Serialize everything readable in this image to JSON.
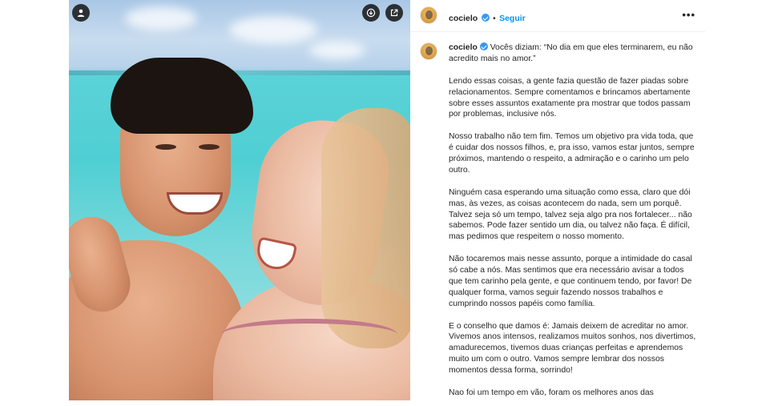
{
  "post": {
    "username": "cocielo",
    "follow_label": "Seguir",
    "separator": "•",
    "more_label": "•••"
  },
  "photo": {
    "description_icon": "user-icon",
    "top_right_icons": [
      "download-icon",
      "open-external-icon"
    ]
  },
  "caption": {
    "username": "cocielo",
    "paragraphs": [
      "Vocês diziam: “No dia em que eles terminarem, eu não acredito mais no amor.”",
      "Lendo essas coisas, a gente fazia questão de fazer piadas sobre relacionamentos. Sempre comentamos e brincamos abertamente sobre esses assuntos exatamente pra mostrar que todos passam por problemas, inclusive nós.",
      "Nosso trabalho não tem fim. Temos um objetivo pra vida toda, que é cuidar dos nossos filhos, e, pra isso, vamos estar juntos, sempre próximos, mantendo o respeito, a admiração e o carinho um pelo outro.",
      "Ninguém casa esperando uma situação como essa, claro que dói mas, às vezes, as coisas acontecem do nada, sem um porquê. Talvez seja só um tempo, talvez seja algo pra nos fortalecer... não sabemos. Pode fazer sentido um dia, ou talvez não faça. É difícil, mas pedimos que respeitem o nosso momento.",
      "Não tocaremos mais nesse assunto, porque a intimidade do casal só cabe a nós. Mas sentimos que era necessário avisar a todos que tem carinho pela gente, e que continuem tendo, por favor! De qualquer forma, vamos seguir fazendo nossos trabalhos e cumprindo nossos papéis como família.",
      "E o conselho que damos é: Jamais deixem de acreditar no amor. Vivemos anos intensos, realizamos muitos sonhos, nos divertimos, amadurecemos, tivemos duas crianças perfeitas e aprendemos muito um com o outro. Vamos sempre lembrar dos nossos momentos dessa forma, sorrindo!",
      "Nao foi um tempo em vão, foram os melhores anos das"
    ]
  },
  "colors": {
    "follow": "#0095f6",
    "verified": "#3897f0",
    "text": "#262626"
  }
}
